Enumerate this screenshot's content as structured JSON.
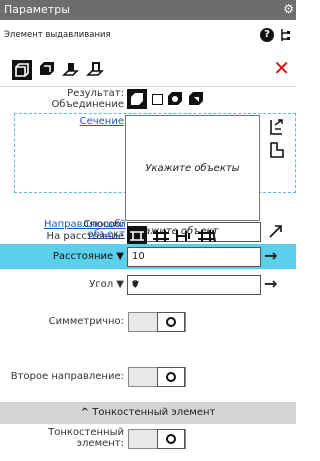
{
  "window": {
    "title": "Параметры",
    "gear_glyph": "⚙"
  },
  "header": {
    "subtitle": "Элемент выдавливания"
  },
  "toolbar": {
    "icons": [
      "extrude-icon",
      "cut-extrude-icon",
      "extrude-boss-icon",
      "extrude-cut-icon"
    ]
  },
  "result": {
    "label": "Результат:",
    "value": "Объединение"
  },
  "section": {
    "label": "Сечение",
    "placeholder": "Укажите объекты"
  },
  "direction": {
    "label": "Направляющий объект",
    "value": "Укажите объект"
  },
  "method": {
    "label": "Способ:",
    "value": "На расстояние"
  },
  "distance": {
    "label": "Расстояние ▼",
    "value": "10"
  },
  "angle": {
    "label": "Угол ▼",
    "value": "0"
  },
  "symmetric": {
    "label": "Симметрично:"
  },
  "second_direction": {
    "label": "Второе направление:"
  },
  "thin_section": {
    "title": "Тонкостенный элемент",
    "chevron": "^"
  },
  "thin_element": {
    "label": "Тонкостенный элемент:"
  },
  "arrow_glyph": "→",
  "colors": {
    "accent": "#5ccfea",
    "close": "#e01010",
    "link": "#1a57c9"
  }
}
